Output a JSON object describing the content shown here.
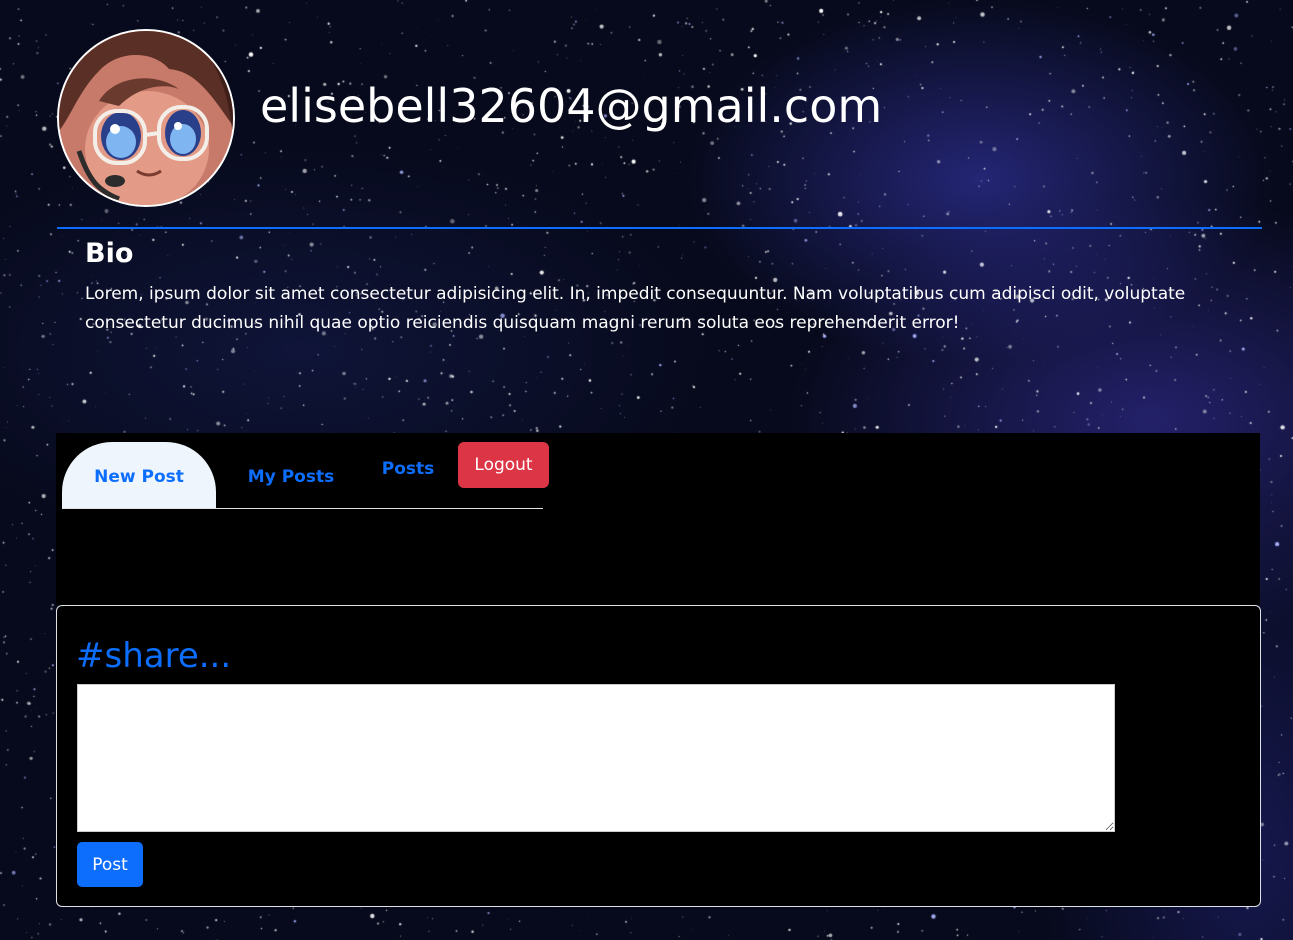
{
  "profile": {
    "email": "elisebell32604@gmail.com",
    "bio_heading": "Bio",
    "bio_text": "Lorem, ipsum dolor sit amet consectetur adipisicing elit. In, impedit consequuntur. Nam voluptatibus cum adipisci odit, voluptate consectetur ducimus nihil quae optio reiciendis quisquam magni rerum soluta eos reprehenderit error!"
  },
  "tabs": {
    "items": [
      {
        "label": "New Post",
        "active": true
      },
      {
        "label": "My Posts",
        "active": false
      },
      {
        "label": "Posts",
        "active": false
      }
    ],
    "logout_label": "Logout"
  },
  "share": {
    "title": "#share...",
    "input_value": "",
    "post_label": "Post"
  },
  "colors": {
    "accent": "#0d6efd",
    "danger": "#dc3545",
    "active_tab_bg": "#eef5fc",
    "panel_bg": "#000000"
  }
}
